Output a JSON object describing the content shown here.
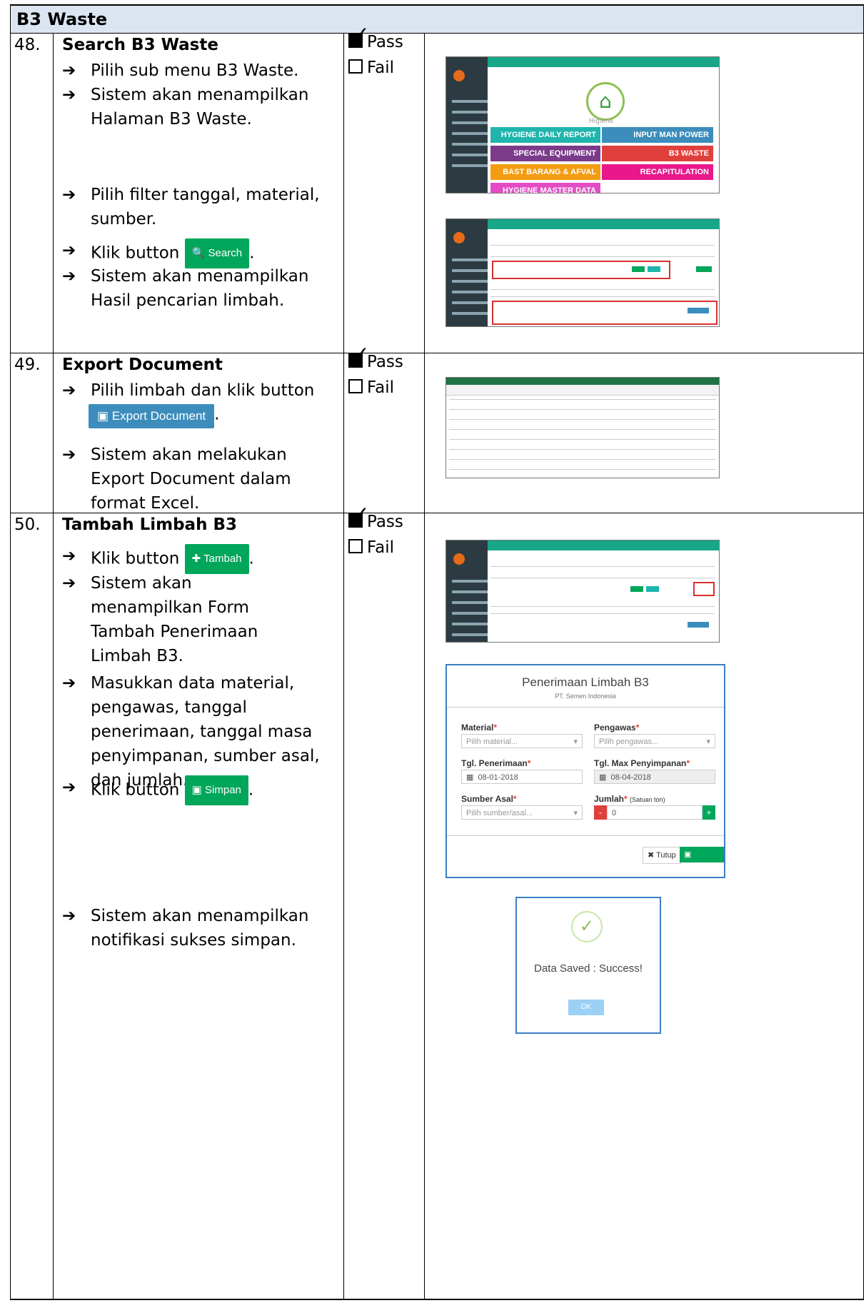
{
  "section_title": "B3 Waste",
  "rows": [
    {
      "number": "48.",
      "title": "Search B3 Waste",
      "steps": [
        "Pilih sub menu B3 Waste.",
        "Sistem akan menampilkan Halaman B3 Waste.",
        "Pilih filter tanggal, material, sumber.",
        "Klik button",
        "Sistem akan menampilkan Hasil pencarian limbah."
      ],
      "button_label": "Search",
      "pass": "Pass",
      "fail": "Fail"
    },
    {
      "number": "49.",
      "title": "Export Document",
      "steps": [
        "Pilih limbah dan klik button",
        "Sistem akan melakukan Export Document dalam format Excel."
      ],
      "button_label": "Export Document",
      "pass": "Pass",
      "fail": "Fail"
    },
    {
      "number": "50.",
      "title": "Tambah Limbah B3",
      "steps": [
        "Klik button",
        "Sistem akan menampilkan Form Tambah Penerimaan Limbah B3.",
        "Masukkan data material, pengawas, tanggal penerimaan, tanggal masa penyimpanan, sumber asal, dan jumlah.",
        "Klik button",
        "Sistem akan menampilkan notifikasi sukses simpan."
      ],
      "button_tambah": "Tambah",
      "button_simpan": "Simpan",
      "pass": "Pass",
      "fail": "Fail"
    }
  ],
  "screenshot_hygiene": {
    "section": "Higiene",
    "tiles": [
      {
        "label": "HYGIENE DAILY REPORT",
        "color": "#1fb5ad"
      },
      {
        "label": "INPUT MAN POWER",
        "color": "#3c8dbc"
      },
      {
        "label": "SPECIAL EQUIPMENT",
        "color": "#7b3a8a"
      },
      {
        "label": "B3 WASTE",
        "color": "#e0403c"
      },
      {
        "label": "BAST BARANG & AFVAL",
        "color": "#f39c12"
      },
      {
        "label": "RECAPITULATION",
        "color": "#e8188b"
      },
      {
        "label": "HYGIENE MASTER DATA",
        "color": "#e34cc5"
      }
    ]
  },
  "form_modal": {
    "title": "Penerimaan Limbah B3",
    "subtitle": "PT. Semen Indonesia",
    "material_label": "Material",
    "material_placeholder": "Pilih material...",
    "pengawas_label": "Pengawas",
    "pengawas_placeholder": "Pilih pengawas...",
    "tgl_penerimaan_label": "Tgl. Penerimaan",
    "tgl_penerimaan_value": "08-01-2018",
    "tgl_max_label": "Tgl. Max Penyimpanan",
    "tgl_max_value": "08-04-2018",
    "sumber_label": "Sumber Asal",
    "sumber_placeholder": "Pilih sumber/asal...",
    "jumlah_label": "Jumlah",
    "jumlah_unit": "(Satuan ton)",
    "jumlah_value": "0",
    "minus": "-",
    "plus": "+",
    "close_label": "Tutup",
    "save_label": "Simpan"
  },
  "success_modal": {
    "message": "Data Saved : Success!",
    "ok": "OK"
  }
}
